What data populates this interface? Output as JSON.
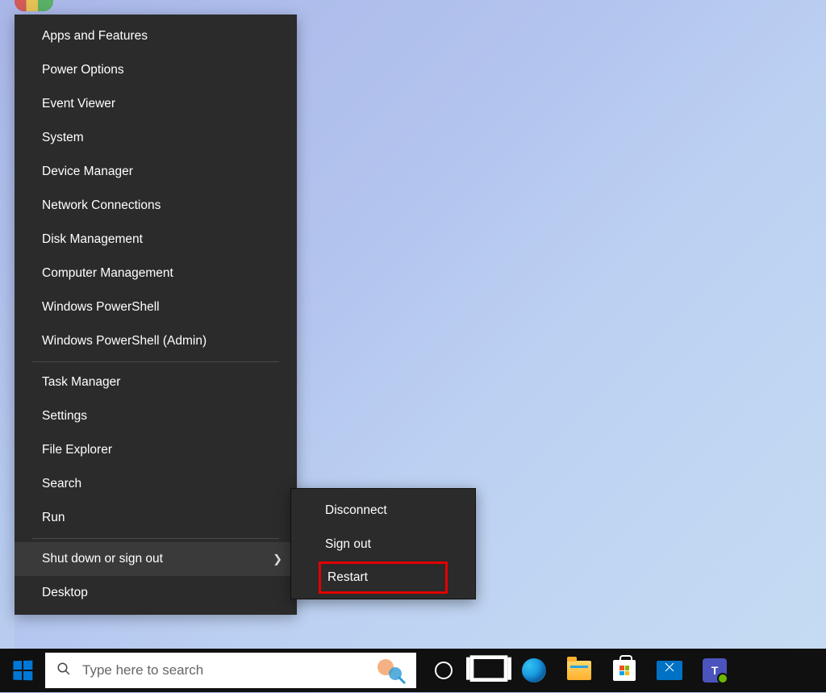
{
  "winx_menu": {
    "group1": [
      {
        "label": "Apps and Features"
      },
      {
        "label": "Power Options"
      },
      {
        "label": "Event Viewer"
      },
      {
        "label": "System"
      },
      {
        "label": "Device Manager"
      },
      {
        "label": "Network Connections"
      },
      {
        "label": "Disk Management"
      },
      {
        "label": "Computer Management"
      },
      {
        "label": "Windows PowerShell"
      },
      {
        "label": "Windows PowerShell (Admin)"
      }
    ],
    "group2": [
      {
        "label": "Task Manager"
      },
      {
        "label": "Settings"
      },
      {
        "label": "File Explorer"
      },
      {
        "label": "Search"
      },
      {
        "label": "Run"
      }
    ],
    "group3": [
      {
        "label": "Shut down or sign out",
        "submenu": true,
        "hovered": true
      },
      {
        "label": "Desktop"
      }
    ]
  },
  "submenu": {
    "items": [
      {
        "label": "Disconnect"
      },
      {
        "label": "Sign out"
      },
      {
        "label": "Restart",
        "highlighted": true
      }
    ]
  },
  "taskbar": {
    "search_placeholder": "Type here to search"
  }
}
